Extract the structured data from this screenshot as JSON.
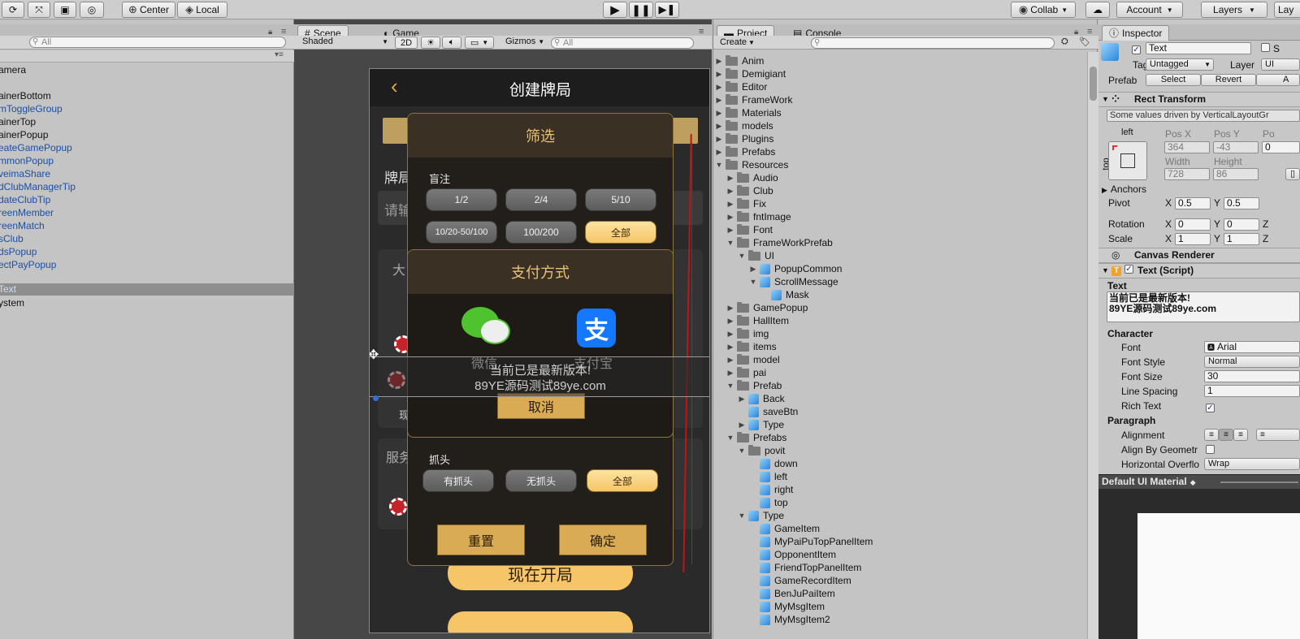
{
  "toolbar": {
    "pivot_mode": "Center",
    "pivot_rotation": "Local",
    "collab": "Collab",
    "account": "Account",
    "layers": "Layers",
    "layout_partial": "Lay"
  },
  "hierarchy": {
    "search_placeholder": "All",
    "items": [
      {
        "label": "amera",
        "color": "#111111"
      },
      {
        "label": "ainerBottom",
        "color": "#111111"
      },
      {
        "label": "mToggleGroup",
        "color": "#1a4fa8"
      },
      {
        "label": "ainerTop",
        "color": "#111111"
      },
      {
        "label": "ainerPopup",
        "color": "#111111"
      },
      {
        "label": "eateGamePopup",
        "color": "#1a4fa8"
      },
      {
        "label": "mmonPopup",
        "color": "#1a4fa8"
      },
      {
        "label": "veimaShare",
        "color": "#1a4fa8"
      },
      {
        "label": "dClubManagerTip",
        "color": "#1a4fa8"
      },
      {
        "label": "dateClubTip",
        "color": "#1a4fa8"
      },
      {
        "label": "reenMember",
        "color": "#1a4fa8"
      },
      {
        "label": "reenMatch",
        "color": "#1a4fa8"
      },
      {
        "label": "sClub",
        "color": "#1a4fa8"
      },
      {
        "label": "dsPopup",
        "color": "#1a4fa8"
      },
      {
        "label": "ectPayPopup",
        "color": "#1a4fa8"
      }
    ],
    "selected": "Text",
    "after_selected": "ystem"
  },
  "scene": {
    "tabs": [
      "Scene",
      "Game"
    ],
    "shading": "Shaded",
    "mode_2d": "2D",
    "gizmos": "Gizmos",
    "search_placeholder": "All"
  },
  "game": {
    "header_title": "创建牌局",
    "bg_label_1": "牌局",
    "bg_label_2": "请输",
    "bg_label_3": "大",
    "bg_label_4": "服务",
    "bg_label_5": "现",
    "start_button": "现在开局",
    "filter": {
      "title": "筛选",
      "blind_label": "盲注",
      "blind_options": [
        "1/2",
        "2/4",
        "5/10",
        "10/20-50/100",
        "100/200",
        "全部"
      ],
      "grab_label": "抓头",
      "grab_options": [
        "有抓头",
        "无抓头",
        "全部"
      ],
      "reset": "重置",
      "confirm": "确定"
    },
    "pay": {
      "title": "支付方式",
      "wechat": "微信",
      "alipay": "支付宝",
      "alipay_glyph": "支",
      "cancel": "取消"
    },
    "overlay_text_1": "当前已是最新版本!",
    "overlay_text_2": "89YE源码测试89ye.com"
  },
  "project": {
    "tabs": [
      "Project",
      "Console"
    ],
    "create": "Create",
    "tree": [
      {
        "label": "Anim",
        "depth": 0,
        "icon": "folder",
        "arrow": "▶"
      },
      {
        "label": "Demigiant",
        "depth": 0,
        "icon": "folder",
        "arrow": "▶"
      },
      {
        "label": "Editor",
        "depth": 0,
        "icon": "folder",
        "arrow": "▶"
      },
      {
        "label": "FrameWork",
        "depth": 0,
        "icon": "folder",
        "arrow": "▶"
      },
      {
        "label": "Materials",
        "depth": 0,
        "icon": "folder",
        "arrow": "▶"
      },
      {
        "label": "models",
        "depth": 0,
        "icon": "folder",
        "arrow": "▶"
      },
      {
        "label": "Plugins",
        "depth": 0,
        "icon": "folder",
        "arrow": "▶"
      },
      {
        "label": "Prefabs",
        "depth": 0,
        "icon": "folder",
        "arrow": "▶"
      },
      {
        "label": "Resources",
        "depth": 0,
        "icon": "folder",
        "arrow": "▼"
      },
      {
        "label": "Audio",
        "depth": 1,
        "icon": "folder",
        "arrow": "▶"
      },
      {
        "label": "Club",
        "depth": 1,
        "icon": "folder",
        "arrow": "▶"
      },
      {
        "label": "Fix",
        "depth": 1,
        "icon": "folder",
        "arrow": "▶"
      },
      {
        "label": "fntImage",
        "depth": 1,
        "icon": "folder",
        "arrow": "▶"
      },
      {
        "label": "Font",
        "depth": 1,
        "icon": "folder",
        "arrow": "▶"
      },
      {
        "label": "FrameWorkPrefab",
        "depth": 1,
        "icon": "folder",
        "arrow": "▼"
      },
      {
        "label": "UI",
        "depth": 2,
        "icon": "folder",
        "arrow": "▼"
      },
      {
        "label": "PopupCommon",
        "depth": 3,
        "icon": "cube",
        "arrow": "▶"
      },
      {
        "label": "ScrollMessage",
        "depth": 3,
        "icon": "cube",
        "arrow": "▼"
      },
      {
        "label": "Mask",
        "depth": 4,
        "icon": "cube",
        "arrow": ""
      },
      {
        "label": "GamePopup",
        "depth": 1,
        "icon": "folder",
        "arrow": "▶"
      },
      {
        "label": "HallItem",
        "depth": 1,
        "icon": "folder",
        "arrow": "▶"
      },
      {
        "label": "img",
        "depth": 1,
        "icon": "folder",
        "arrow": "▶"
      },
      {
        "label": "items",
        "depth": 1,
        "icon": "folder",
        "arrow": "▶"
      },
      {
        "label": "model",
        "depth": 1,
        "icon": "folder",
        "arrow": "▶"
      },
      {
        "label": "pai",
        "depth": 1,
        "icon": "folder",
        "arrow": "▶"
      },
      {
        "label": "Prefab",
        "depth": 1,
        "icon": "folder",
        "arrow": "▼"
      },
      {
        "label": "Back",
        "depth": 2,
        "icon": "cube",
        "arrow": "▶"
      },
      {
        "label": "saveBtn",
        "depth": 2,
        "icon": "cube",
        "arrow": ""
      },
      {
        "label": "Type",
        "depth": 2,
        "icon": "cube",
        "arrow": "▶"
      },
      {
        "label": "Prefabs",
        "depth": 1,
        "icon": "folder",
        "arrow": "▼"
      },
      {
        "label": "povit",
        "depth": 2,
        "icon": "folder",
        "arrow": "▼"
      },
      {
        "label": "down",
        "depth": 3,
        "icon": "cube",
        "arrow": ""
      },
      {
        "label": "left",
        "depth": 3,
        "icon": "cube",
        "arrow": ""
      },
      {
        "label": "right",
        "depth": 3,
        "icon": "cube",
        "arrow": ""
      },
      {
        "label": "top",
        "depth": 3,
        "icon": "cube",
        "arrow": ""
      },
      {
        "label": "Type",
        "depth": 2,
        "icon": "cube",
        "arrow": "▼"
      },
      {
        "label": "GameItem",
        "depth": 3,
        "icon": "cube",
        "arrow": ""
      },
      {
        "label": "MyPaiPuTopPanelItem",
        "depth": 3,
        "icon": "cube",
        "arrow": ""
      },
      {
        "label": "OpponentItem",
        "depth": 3,
        "icon": "cube",
        "arrow": ""
      },
      {
        "label": "FriendTopPanelItem",
        "depth": 3,
        "icon": "cube",
        "arrow": ""
      },
      {
        "label": "GameRecordItem",
        "depth": 3,
        "icon": "cube",
        "arrow": ""
      },
      {
        "label": "BenJuPaiItem",
        "depth": 3,
        "icon": "cube",
        "arrow": ""
      },
      {
        "label": "MyMsgItem",
        "depth": 3,
        "icon": "cube",
        "arrow": ""
      },
      {
        "label": "MyMsgItem2",
        "depth": 3,
        "icon": "cube",
        "arrow": ""
      }
    ]
  },
  "inspector": {
    "tab": "Inspector",
    "object_name": "Text",
    "static_partial": "S",
    "tag_label": "Tag",
    "tag_value": "Untagged",
    "layer_label": "Layer",
    "layer_value": "UI",
    "prefab_label": "Prefab",
    "prefab_select": "Select",
    "prefab_revert": "Revert",
    "prefab_apply_partial": "A",
    "rect_transform": "Rect Transform",
    "driven_note": "Some values driven by VerticalLayoutGr",
    "anchor_h": "left",
    "anchor_v": "top",
    "pos_x_label": "Pos X",
    "pos_y_label": "Pos Y",
    "pos_z_partial": "Po",
    "pos_x": "364",
    "pos_y": "-43",
    "pos_z": "0",
    "width_label": "Width",
    "height_label": "Height",
    "width": "728",
    "height": "86",
    "anchors": "Anchors",
    "pivot_label": "Pivot",
    "pivot_x": "0.5",
    "pivot_y": "0.5",
    "rotation_label": "Rotation",
    "rot_x": "0",
    "rot_y": "0",
    "scale_label": "Scale",
    "scale_x": "1",
    "scale_y": "1",
    "x_axis": "X",
    "y_axis": "Y",
    "z_axis": "Z",
    "canvas_renderer": "Canvas Renderer",
    "text_script": "Text (Script)",
    "text_label": "Text",
    "text_value_1": "当前已是最新版本!",
    "text_value_2": "89YE源码测试89ye.com",
    "character": "Character",
    "font_label": "Font",
    "font_value": "Arial",
    "font_style_label": "Font Style",
    "font_style_value": "Normal",
    "font_size_label": "Font Size",
    "font_size_value": "30",
    "line_spacing_label": "Line Spacing",
    "line_spacing_value": "1",
    "rich_text_label": "Rich Text",
    "paragraph": "Paragraph",
    "alignment_label": "Alignment",
    "align_geom_label": "Align By Geometr",
    "h_overflow_label": "Horizontal Overflo",
    "h_overflow_value": "Wrap",
    "material": "Default UI Material"
  },
  "colors": {
    "selection": "#8fa6c8",
    "game_bg": "#2a2a2a",
    "gold": "#f5c568",
    "wechat_green": "#39c33a",
    "alipay_blue": "#1677ff"
  }
}
